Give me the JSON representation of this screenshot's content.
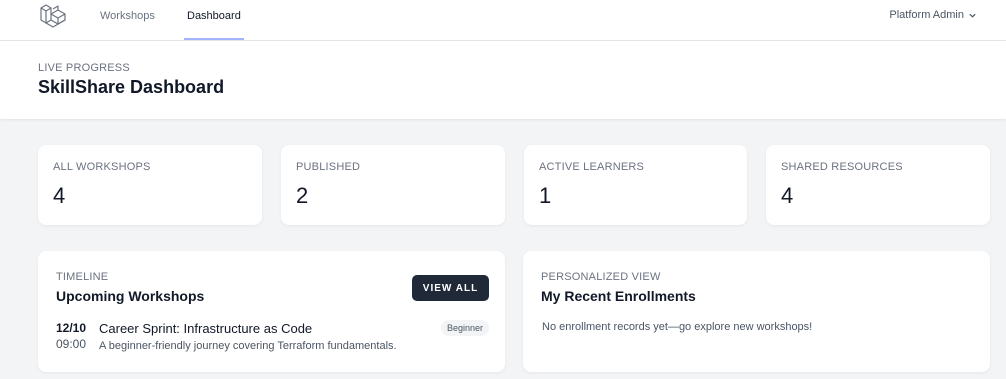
{
  "nav": {
    "links": [
      {
        "label": "Workshops",
        "active": false
      },
      {
        "label": "Dashboard",
        "active": true
      }
    ],
    "user": {
      "name": "Platform Admin",
      "icon": "chevron-down-icon"
    },
    "logo_icon": "laravel-logo"
  },
  "header": {
    "eyebrow": "LIVE PROGRESS",
    "title": "SkillShare Dashboard"
  },
  "stats": [
    {
      "label": "ALL WORKSHOPS",
      "value": "4"
    },
    {
      "label": "PUBLISHED",
      "value": "2"
    },
    {
      "label": "ACTIVE LEARNERS",
      "value": "1"
    },
    {
      "label": "SHARED RESOURCES",
      "value": "4"
    }
  ],
  "timeline": {
    "eyebrow": "TIMELINE",
    "title": "Upcoming Workshops",
    "view_all_label": "VIEW ALL",
    "items": [
      {
        "date": "12/10",
        "time": "09:00",
        "title": "Career Sprint: Infrastructure as Code",
        "description": "A beginner-friendly journey covering Terraform fundamentals.",
        "level": "Beginner"
      }
    ]
  },
  "enrollments": {
    "eyebrow": "PERSONALIZED VIEW",
    "title": "My Recent Enrollments",
    "empty_message": "No enrollment records yet—go explore new workshops!"
  },
  "colors": {
    "accent_underline": "#a5b4fc",
    "button_bg": "#1f2937",
    "page_bg": "#f3f4f6"
  }
}
